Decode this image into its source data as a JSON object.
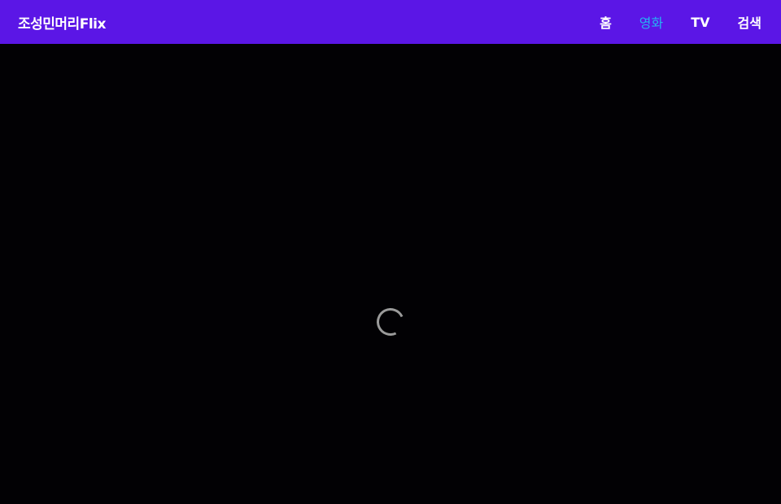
{
  "header": {
    "logo": "조성민머리Flix",
    "nav": [
      {
        "label": "홈",
        "active": false
      },
      {
        "label": "영화",
        "active": true
      },
      {
        "label": "TV",
        "active": false
      },
      {
        "label": "검색",
        "active": false
      }
    ]
  },
  "colors": {
    "header_bg": "#5b16e6",
    "active_nav": "#25b4f2",
    "page_bg": "#020104",
    "spinner": "#9a9a9a"
  },
  "main": {
    "state": "loading",
    "spinner_icon": "loading-spinner-icon"
  }
}
